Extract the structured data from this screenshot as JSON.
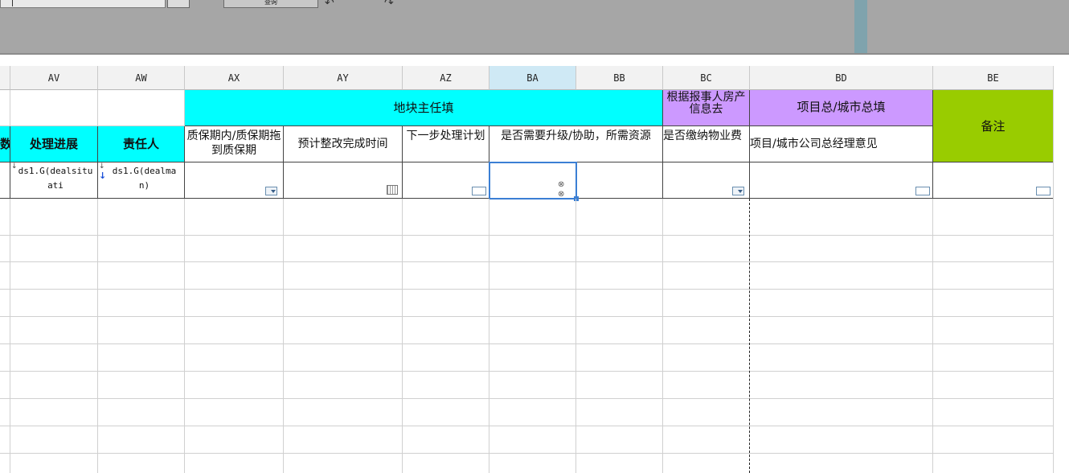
{
  "toolbar": {
    "button_label": "查询",
    "undo_icon": "undo-icon",
    "redo_icon": "redo-icon"
  },
  "columns": [
    {
      "id": "AU",
      "label": ""
    },
    {
      "id": "AV",
      "label": "AV"
    },
    {
      "id": "AW",
      "label": "AW"
    },
    {
      "id": "AX",
      "label": "AX"
    },
    {
      "id": "AY",
      "label": "AY"
    },
    {
      "id": "AZ",
      "label": "AZ"
    },
    {
      "id": "BA",
      "label": "BA"
    },
    {
      "id": "BB",
      "label": "BB"
    },
    {
      "id": "BC",
      "label": "BC"
    },
    {
      "id": "BD",
      "label": "BD"
    },
    {
      "id": "BE",
      "label": "BE"
    }
  ],
  "groups": {
    "block_owner": "地块主任填",
    "report_info": "根据报事人房产信息去",
    "project_city": "项目总/城市总填",
    "remark": "备注"
  },
  "subheaders": {
    "au": "数",
    "av": "处理进展",
    "aw": "责任人",
    "ax": "质保期内/质保期拖到质保期",
    "ay": "预计整改完成时间",
    "az": "下一步处理计划",
    "ba_bb": "是否需要升级/协助，所需资源",
    "bc": "是否缴纳物业费",
    "bd": "项目/城市公司总经理意见"
  },
  "datarow": {
    "av": "ds1.G(dealsituati",
    "aw": "ds1.G(dealman)"
  },
  "colors": {
    "cyan": "#00ffff",
    "purple": "#cc99ff",
    "green": "#99cc00",
    "selection": "#3b7fd4"
  }
}
